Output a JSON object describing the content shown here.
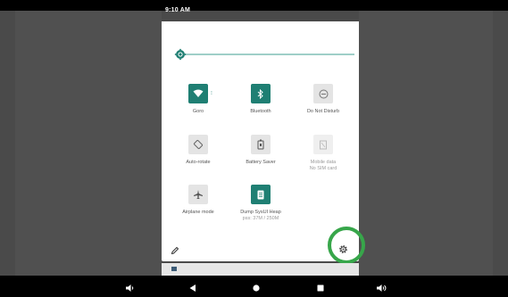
{
  "status_bar": {
    "time": "9:10 AM"
  },
  "quick_settings": {
    "brightness": {
      "level": 0.0
    },
    "tiles": [
      {
        "label": "Goro",
        "sub": "",
        "state": "on",
        "icon": "wifi-icon"
      },
      {
        "label": "Bluetooth",
        "sub": "",
        "state": "on",
        "icon": "bluetooth-icon"
      },
      {
        "label": "Do Not Disturb",
        "sub": "",
        "state": "off",
        "icon": "do-not-disturb-icon"
      },
      {
        "label": "Auto-rotate",
        "sub": "",
        "state": "off",
        "icon": "auto-rotate-icon"
      },
      {
        "label": "Battery Saver",
        "sub": "",
        "state": "off",
        "icon": "battery-saver-icon"
      },
      {
        "label": "Mobile data",
        "sub": "No SIM card",
        "state": "disabled",
        "icon": "mobile-data-icon"
      },
      {
        "label": "Airplane mode",
        "sub": "",
        "state": "off",
        "icon": "airplane-icon"
      },
      {
        "label": "Dump SysUI Heap",
        "sub": "pss: 37M / 250M",
        "state": "on",
        "icon": "heap-dump-icon"
      }
    ]
  },
  "colors": {
    "accent": "#1f7f73",
    "highlight": "#37a64a",
    "panel": "#ffffff"
  },
  "nav_bar": {
    "buttons": [
      "volume-down-icon",
      "back-icon",
      "home-icon",
      "recents-icon",
      "volume-up-icon"
    ]
  }
}
